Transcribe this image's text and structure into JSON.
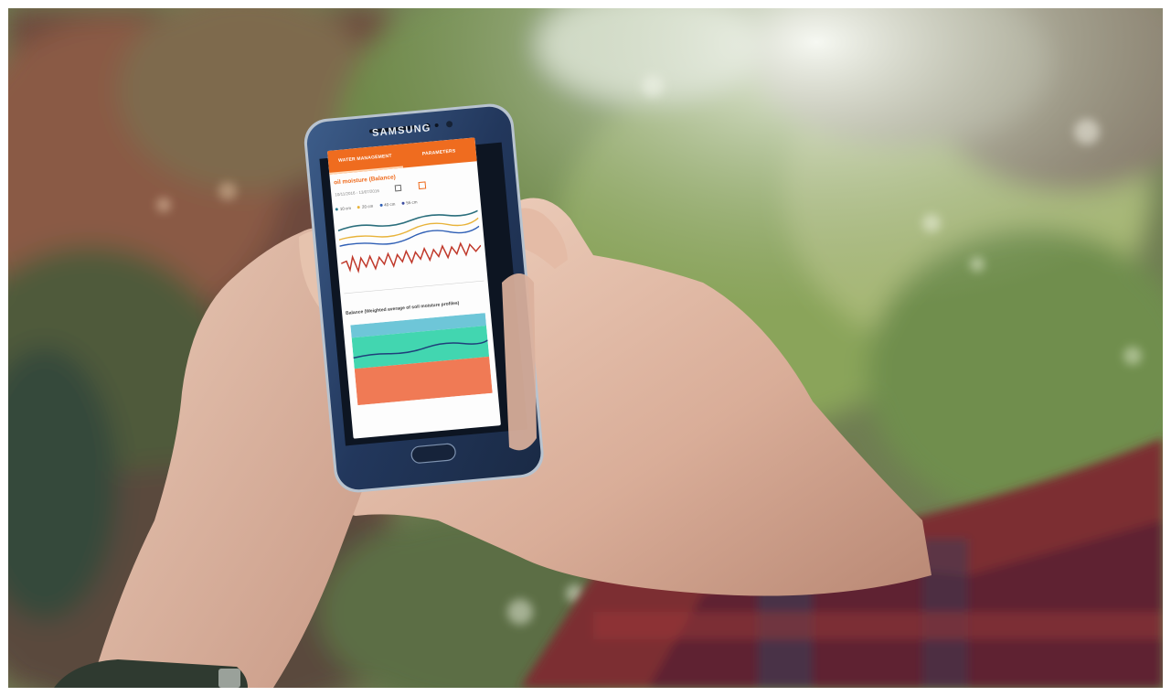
{
  "phone": {
    "brand": "SAMSUNG",
    "tabs": [
      {
        "label": "WATER MANAGEMENT",
        "active": true
      },
      {
        "label": "PARAMETERS",
        "active": false
      }
    ],
    "card1": {
      "title": "oil moisture (Balance)",
      "date_range": "10/11/2016 - 13/07/2016",
      "legend": [
        {
          "label": "10 cm",
          "color": "#2a7b8f"
        },
        {
          "label": "20 cm",
          "color": "#e8b33a"
        },
        {
          "label": "40 cm",
          "color": "#2f5fb5"
        },
        {
          "label": "55 cm",
          "color": "#3c4ba0"
        },
        {
          "label": "Sum",
          "color": "#9fd6d0"
        }
      ]
    },
    "card2": {
      "title": "Balance (Weighted average of soil moisture profiles)"
    },
    "colors": {
      "accent": "#ef6c1f",
      "zone_top": "#6ec6d8",
      "zone_mid": "#42d6b0",
      "zone_bottom": "#f07a55",
      "line_red": "#c0392b"
    }
  }
}
